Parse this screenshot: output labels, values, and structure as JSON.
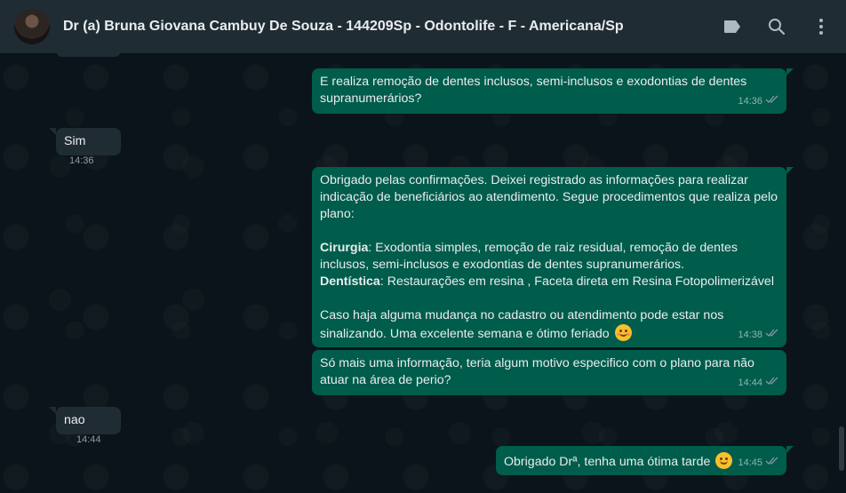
{
  "header": {
    "title": "Dr (a) Bruna Giovana Cambuy De Souza - 144209Sp - Odontolife - F - Americana/Sp",
    "icons": [
      "label-icon",
      "search-icon",
      "menu-icon"
    ]
  },
  "messages": [
    {
      "dir": "out",
      "text": "E realiza remoção de dentes inclusos, semi-inclusos e exodontias de dentes supranumerários?",
      "time": "14:36"
    },
    {
      "dir": "in",
      "text": "Sim",
      "time": "14:36"
    },
    {
      "dir": "out",
      "parts": {
        "p1": "Obrigado pelas confirmações. Deixei registrado as informações para realizar indicação de beneficiários ao atendimento. Segue procedimentos que realiza pelo plano:",
        "b1": "Cirurgia",
        "t1": ": Exodontia simples, remoção de raiz residual, remoção de dentes inclusos, semi-inclusos e exodontias de dentes supranumerários.",
        "b2": "Dentística",
        "t2": ": Restaurações em resina , Faceta direta em Resina Fotopolimerizável",
        "p3": "Caso haja alguma mudança no cadastro ou atendimento pode estar nos sinalizando. Uma excelente semana e ótimo feriado"
      },
      "emoji": "smiling-face-icon",
      "time": "14:38"
    },
    {
      "dir": "out",
      "text": "Só mais uma informação, teria algum motivo especifico com o plano para não atuar na área de perio?",
      "time": "14:44"
    },
    {
      "dir": "in",
      "text": "nao",
      "time": "14:44"
    },
    {
      "dir": "out",
      "text": "Obrigado Drª, tenha uma ótima tarde",
      "emoji": "smiling-face-icon",
      "time": "14:45"
    }
  ],
  "colors": {
    "outgoing_bubble": "#005c4b",
    "incoming_bubble": "#202c33",
    "background": "#0b141a",
    "header": "#202c33"
  }
}
